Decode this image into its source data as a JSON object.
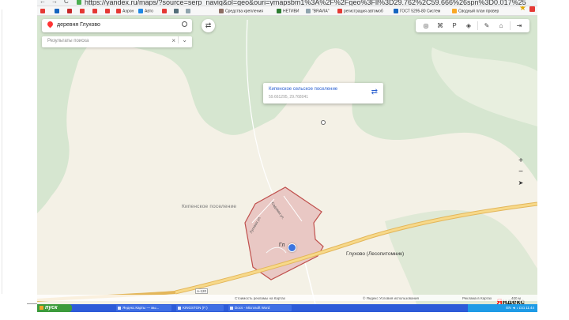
{
  "browser": {
    "nav_back": "←",
    "nav_forward": "→",
    "nav_reload": "C",
    "url": "https://yandex.ru/maps/?source=serp_navig&ol=geo&ouri=ymapsbm1%3A%2F%2Fgeo%3Fll%3D29.762%2C59.666%26spn%3D0.017%25",
    "bookmarks": [
      {
        "label": "",
        "color": "#e53935"
      },
      {
        "label": "",
        "color": "#1565c0"
      },
      {
        "label": "",
        "color": "#c62828"
      },
      {
        "label": "",
        "color": "#e53935"
      },
      {
        "label": "",
        "color": "#e53935"
      },
      {
        "label": "",
        "color": "#e53935"
      },
      {
        "label": "Аэрон",
        "color": "#e53935"
      },
      {
        "label": "Авто",
        "color": "#1e88e5"
      },
      {
        "label": "",
        "color": "#e53935"
      },
      {
        "label": "",
        "color": "#546e7a"
      },
      {
        "label": "",
        "color": "#90a4ae"
      },
      {
        "label": "Средства крепления",
        "color": "#8d6e63"
      },
      {
        "label": "НЕТИВИ",
        "color": "#2e7d32"
      },
      {
        "label": "\"BRAVIA\"",
        "color": "#90a4ae"
      },
      {
        "label": "регистрация автомоб",
        "color": "#e53935"
      },
      {
        "label": "ГОСТ 5295-80 Систем",
        "color": "#1565c0"
      },
      {
        "label": "Сводный план провер",
        "color": "#f9a825"
      }
    ]
  },
  "search": {
    "value": "деревня Глухово",
    "results_placeholder": "Результаты поиска",
    "clear_icon": "×",
    "dropdown_icon": "⌄",
    "route_icon": "⇄"
  },
  "map_controls": {
    "left_group": [
      "◎",
      "⌘",
      "P",
      "◈"
    ],
    "right_group": [
      "✎",
      "⌂",
      "⇥"
    ],
    "zoom_in": "+",
    "zoom_out": "−",
    "locate": "➤"
  },
  "balloon": {
    "title": "Кипенское сельское поселение",
    "coords": "59.661295, 29.768041",
    "route_icon": "⇄"
  },
  "map_labels": {
    "settlement": "Кипенское поселение",
    "village": "Глухово (Лесопитомник)",
    "street_1": "Луговая ул.",
    "street_2": "Садовая ул.",
    "village_short": "Гл",
    "road_number": "А-120"
  },
  "footer": {
    "report": "Сообщить об ошибке",
    "ad_terms": "Стоимость рекламы на Картах",
    "yandex_terms": "© Яндекс  Условия использования",
    "ads": "Реклама в Картах",
    "scale": "400 м",
    "logo_rest": "ндекс",
    "logo_first": "Я"
  },
  "taskbar": {
    "start_label": "пуск",
    "tasks": [
      "Яндекс.Карты — мы...",
      "KINGSTON (F:)",
      "Docs - Microsoft Word"
    ],
    "tray_text": "EN  ◄ ♪ ◘ ◘  11:44"
  },
  "colors": {
    "map_bg": "#d6e6d0",
    "field": "#f4f1e6",
    "village_fill": "#e9c8c4",
    "village_border": "#c0504d",
    "road": "#f0c766",
    "taskbar": "#2d5bd8",
    "start": "#3c9b3c"
  }
}
